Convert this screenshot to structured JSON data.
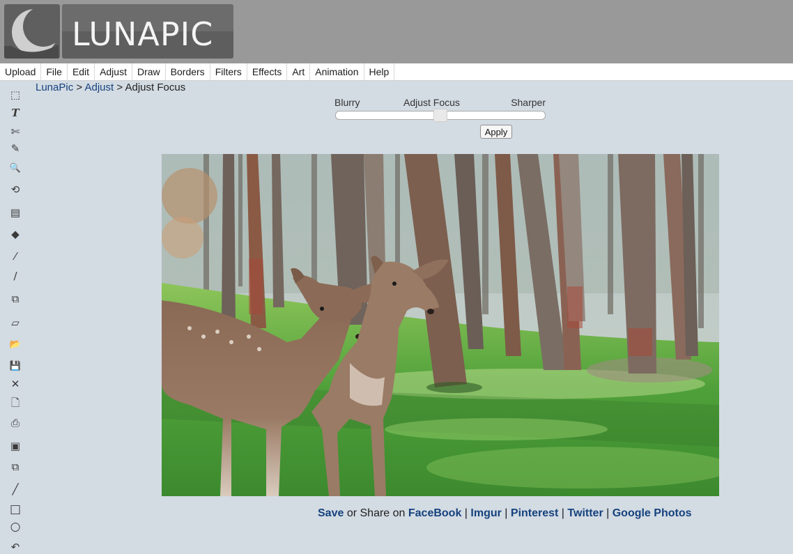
{
  "header": {
    "logo_text": "LUNAPIC",
    "bg_color": "#999999"
  },
  "menu": {
    "items": [
      "Upload",
      "File",
      "Edit",
      "Adjust",
      "Draw",
      "Borders",
      "Filters",
      "Effects",
      "Art",
      "Animation",
      "Help"
    ]
  },
  "toolbar": {
    "tools": [
      {
        "icon": "marquee-select-icon",
        "glyph": "⬚"
      },
      {
        "icon": "text-icon",
        "glyph": "T"
      },
      {
        "icon": "scissors-icon",
        "glyph": "✄"
      },
      {
        "icon": "pencil-icon",
        "glyph": "✎"
      },
      {
        "icon": "zoom-icon",
        "glyph": "🔍"
      },
      {
        "icon": "rotate-icon",
        "glyph": "⟲"
      },
      {
        "icon": "gradient-icon",
        "glyph": "▤"
      },
      {
        "icon": "paint-bucket-icon",
        "glyph": "◆"
      },
      {
        "icon": "eyedropper-icon",
        "glyph": "⁄"
      },
      {
        "icon": "brush-icon",
        "glyph": "∕"
      },
      {
        "icon": "resize-icon",
        "glyph": "⧉"
      },
      {
        "icon": "eraser-icon",
        "glyph": "▱"
      },
      {
        "icon": "open-folder-icon",
        "glyph": "📂"
      },
      {
        "icon": "save-icon",
        "glyph": "💾"
      },
      {
        "icon": "close-icon",
        "glyph": "✕"
      },
      {
        "icon": "new-file-icon",
        "glyph": "🗋"
      },
      {
        "icon": "print-icon",
        "glyph": "⎙"
      },
      {
        "icon": "paste-icon",
        "glyph": "▣"
      },
      {
        "icon": "copy-icon",
        "glyph": "⧉"
      },
      {
        "icon": "line-icon",
        "glyph": "╱"
      },
      {
        "icon": "rectangle-icon",
        "glyph": "□"
      },
      {
        "icon": "circle-icon",
        "glyph": "○"
      },
      {
        "icon": "undo-icon",
        "glyph": "↶"
      }
    ]
  },
  "breadcrumb": {
    "home": "LunaPic",
    "section": "Adjust",
    "current": "Adjust Focus",
    "sep": " > "
  },
  "focus": {
    "left_label": "Blurry",
    "center_label": "Adjust Focus",
    "right_label": "Sharper",
    "slider_value": 0.5,
    "apply_label": "Apply"
  },
  "share": {
    "save": "Save",
    "middle": " or Share on ",
    "links": [
      "FaceBook",
      "Imgur",
      "Pinterest",
      "Twitter",
      "Google Photos"
    ],
    "sep": " | "
  }
}
